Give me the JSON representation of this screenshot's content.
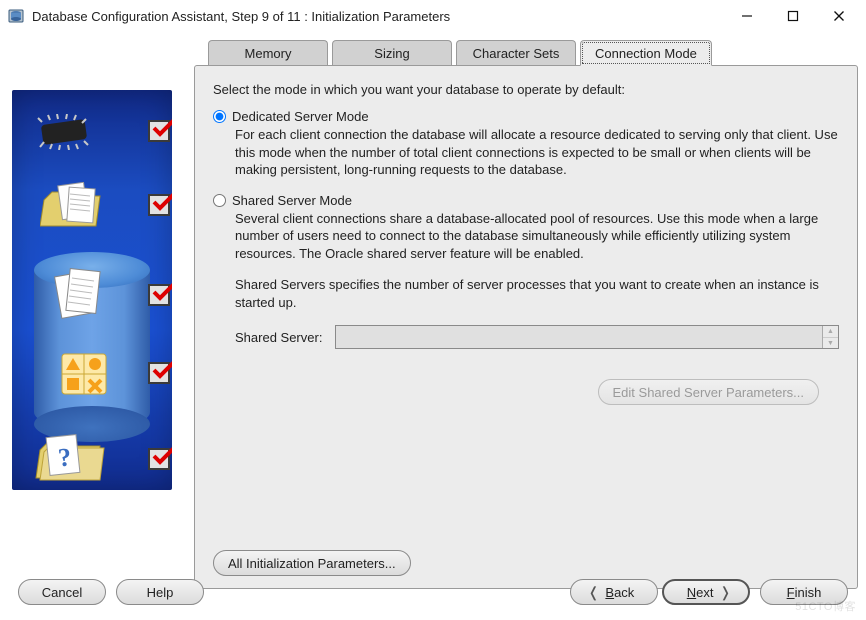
{
  "window": {
    "title": "Database Configuration Assistant, Step 9 of 11 : Initialization Parameters"
  },
  "tabs": {
    "memory": "Memory",
    "sizing": "Sizing",
    "charsets": "Character Sets",
    "conn": "Connection Mode"
  },
  "intro": "Select the mode in which you want your database to operate by default:",
  "dedicated": {
    "label": "Dedicated Server Mode",
    "desc": "For each client connection the database will allocate a resource dedicated to serving only that client.  Use this mode when the number of total client connections is expected to be small or when clients will be making persistent, long-running requests to the database."
  },
  "shared": {
    "label": "Shared Server Mode",
    "desc": "Several client connections share a database-allocated pool of resources.  Use this mode when a large number of users need to connect to the database simultaneously while efficiently utilizing system resources.  The Oracle shared server feature will be enabled.",
    "para": "Shared Servers specifies the number of server processes that you want to create when an instance is started up.",
    "fieldLabel": "Shared Server:",
    "value": "",
    "editBtn": "Edit Shared Server Parameters..."
  },
  "allParams": "All Initialization Parameters...",
  "footer": {
    "cancel": "Cancel",
    "help": "Help",
    "back_pre": "B",
    "back_rest": "ack",
    "next_pre": "N",
    "next_rest": "ext",
    "finish_pre": "F",
    "finish_rest": "inish"
  },
  "watermark": "51CTO博客"
}
